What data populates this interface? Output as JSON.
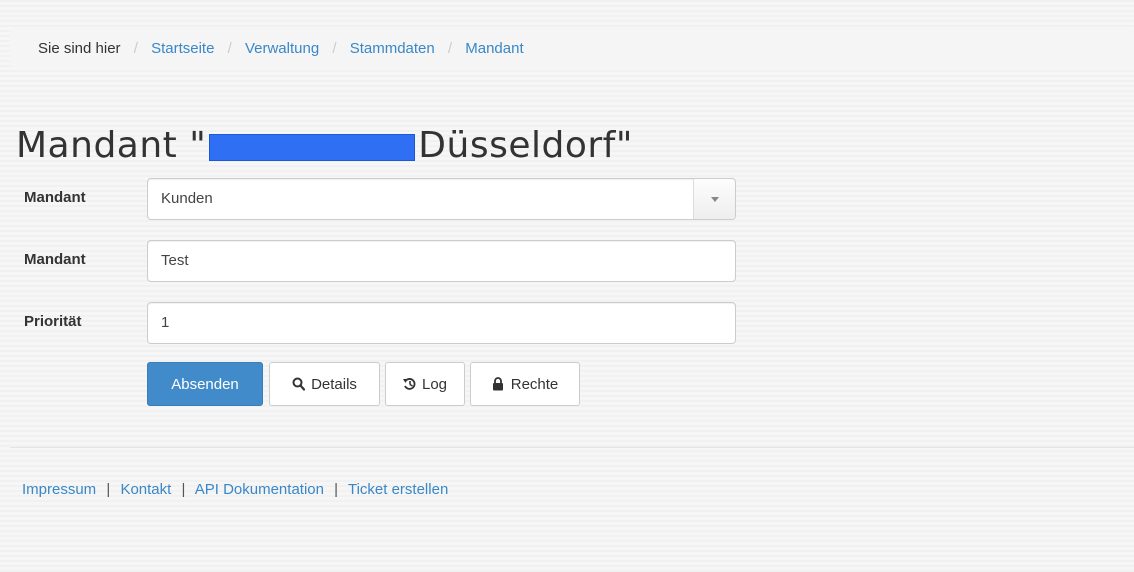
{
  "breadcrumb": {
    "prefix": "Sie sind hier",
    "separator": "/",
    "items": [
      {
        "label": "Startseite"
      },
      {
        "label": "Verwaltung"
      },
      {
        "label": "Stammdaten"
      },
      {
        "label": "Mandant"
      }
    ]
  },
  "page": {
    "title_prefix": "Mandant \"",
    "title_suffix": "Düsseldorf\""
  },
  "form": {
    "fields": [
      {
        "label": "Mandant",
        "type": "select",
        "value": "Kunden"
      },
      {
        "label": "Mandant",
        "type": "text",
        "value": "Test"
      },
      {
        "label": "Priorität",
        "type": "text",
        "value": "1"
      }
    ]
  },
  "buttons": {
    "submit": "Absenden",
    "details": "Details",
    "log": "Log",
    "rights": "Rechte"
  },
  "icons": {
    "details": "search-icon",
    "log": "history-icon",
    "rights": "lock-icon"
  },
  "footer": {
    "separator": "|",
    "links": [
      {
        "label": "Impressum"
      },
      {
        "label": "Kontakt"
      },
      {
        "label": "API Dokumentation"
      },
      {
        "label": "Ticket erstellen"
      }
    ]
  },
  "colors": {
    "link": "#3a87c8",
    "primary": "#428bca",
    "redaction": "#2f6ff3"
  }
}
